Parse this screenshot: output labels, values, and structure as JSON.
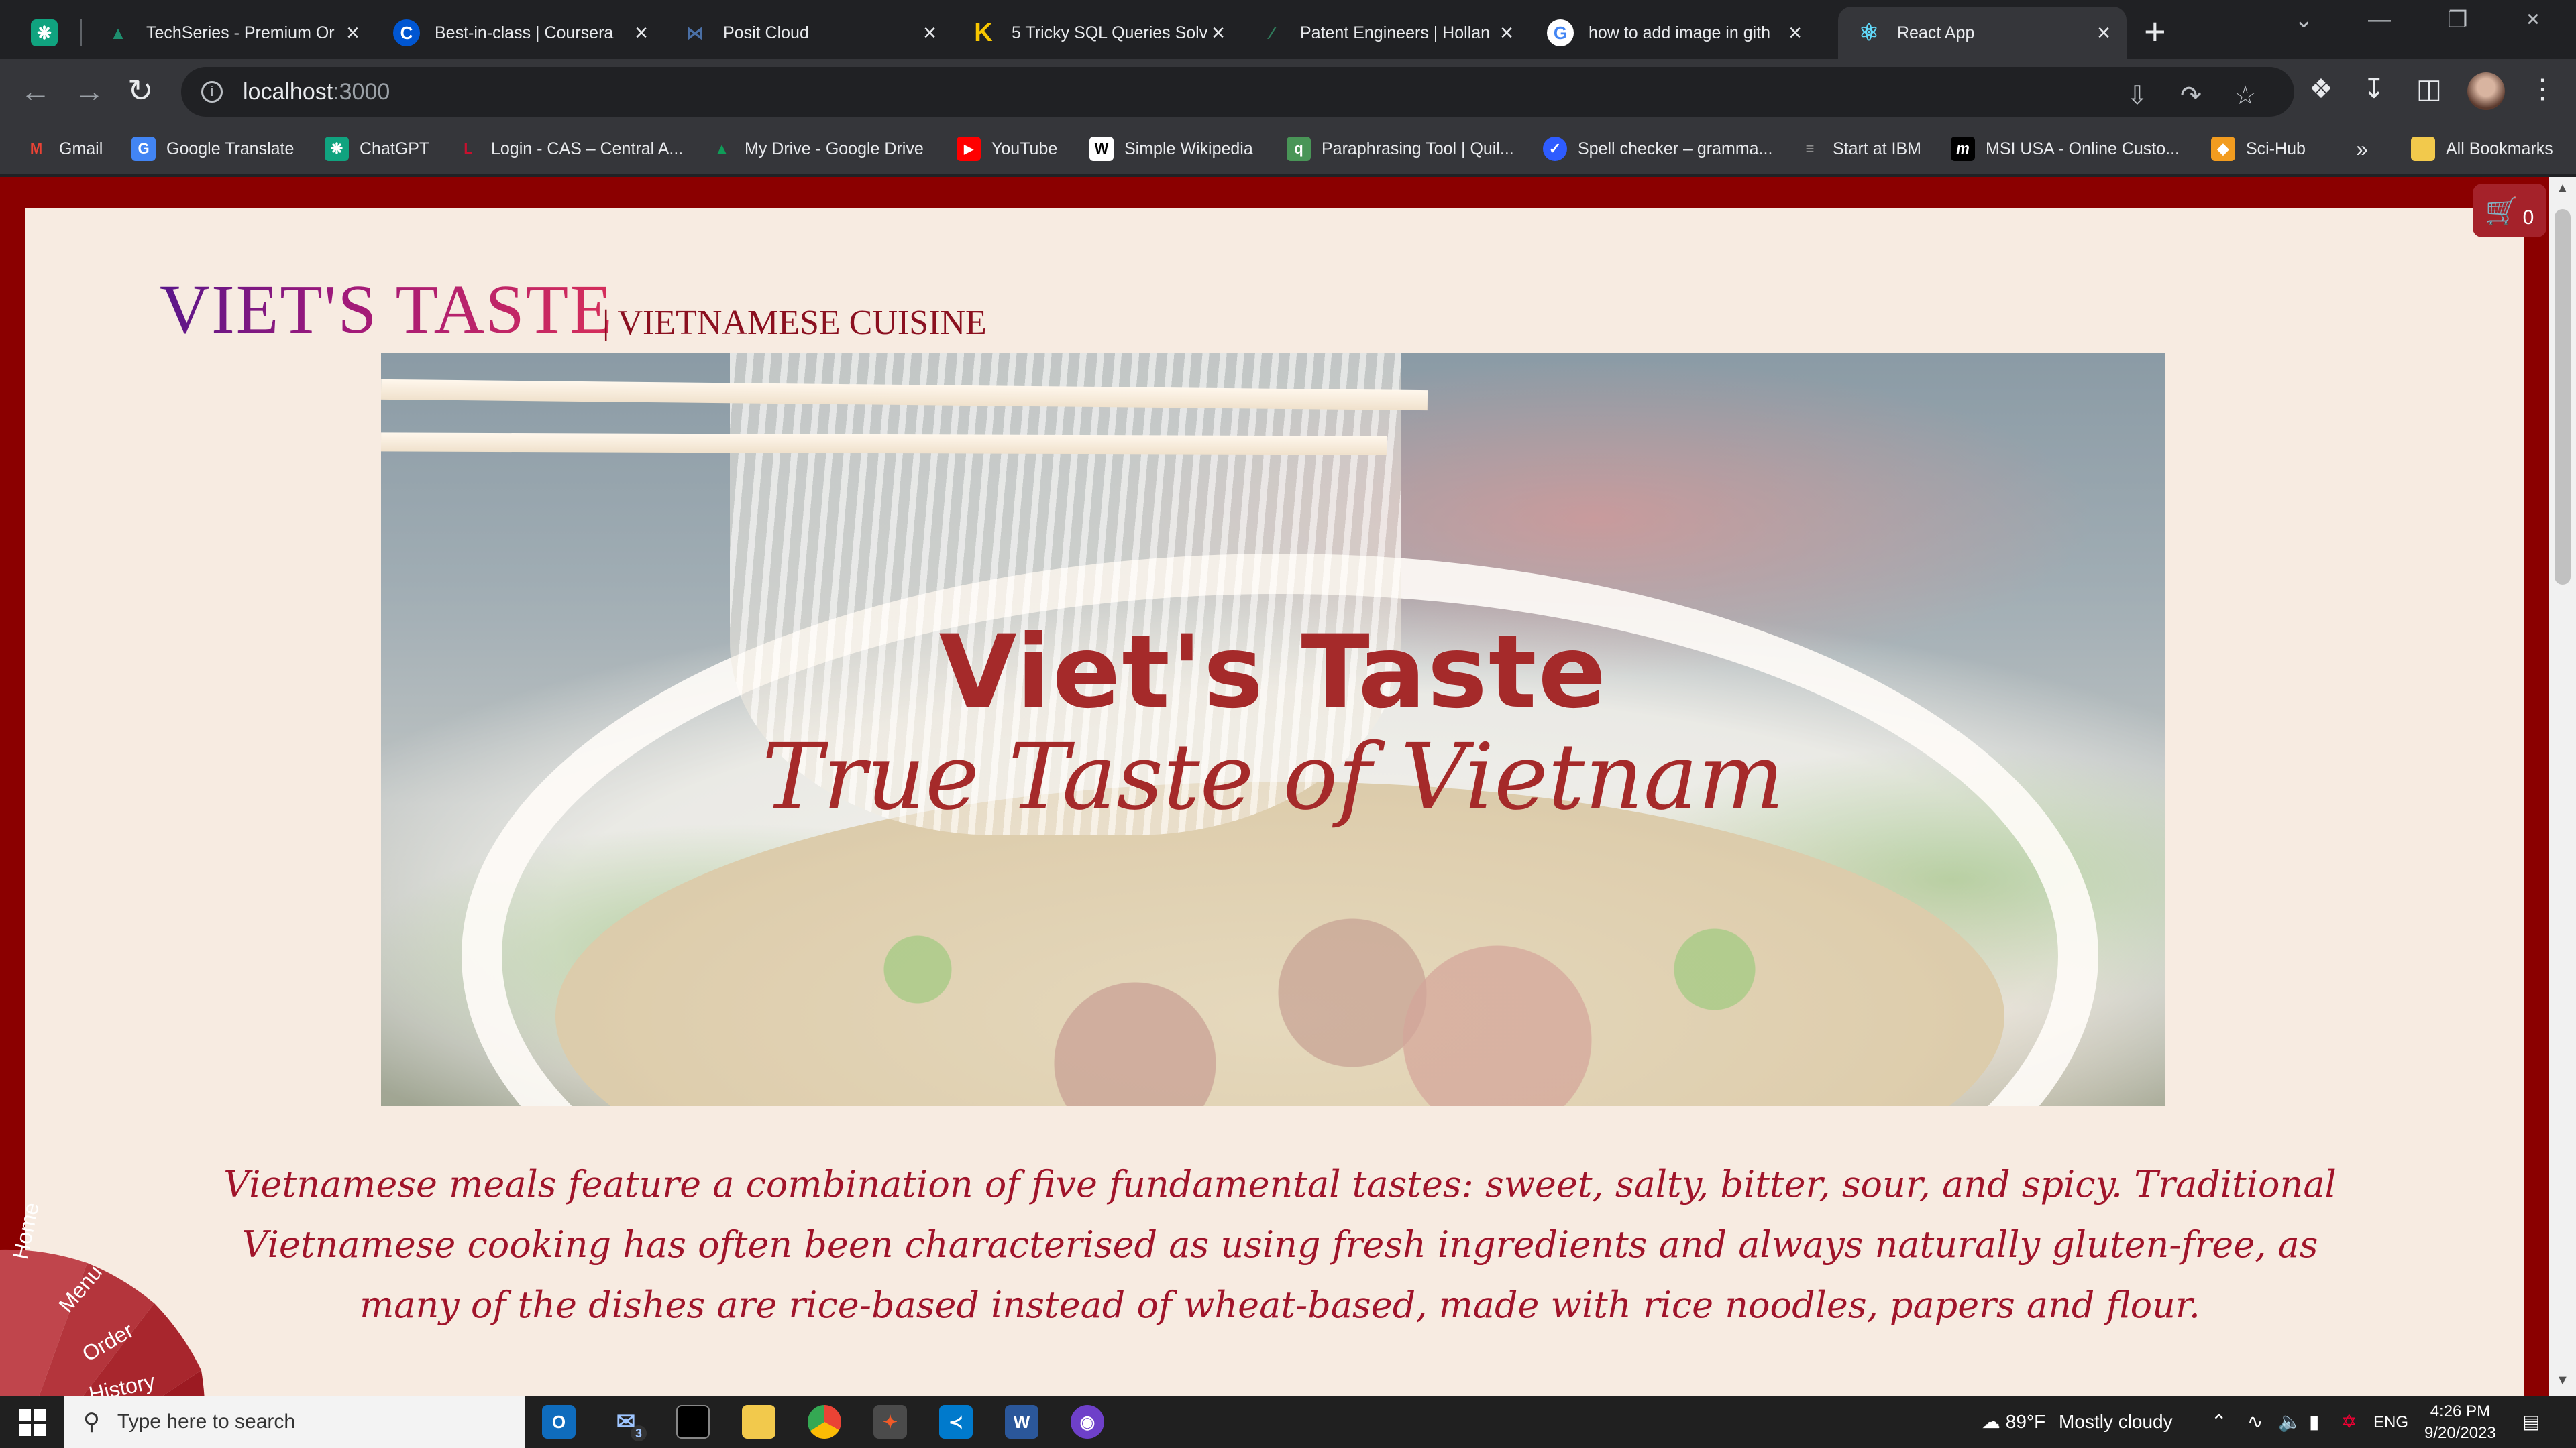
{
  "browser": {
    "tabs": [
      {
        "title": "",
        "favicon": "chatgpt-icon",
        "color": "#10a37f"
      },
      {
        "title": "TechSeries - Premium Or",
        "favicon": "techseries-icon",
        "color": "#1e8e6e"
      },
      {
        "title": "Best-in-class | Coursera",
        "favicon": "coursera-icon",
        "color": "#0056d2"
      },
      {
        "title": "Posit Cloud",
        "favicon": "posit-icon",
        "color": "#4a6fa5"
      },
      {
        "title": "5 Tricky SQL Queries Solv",
        "favicon": "k-icon",
        "color": "#f7c600"
      },
      {
        "title": "Patent Engineers | Hollan",
        "favicon": "patent-icon",
        "color": "#2f7a5a"
      },
      {
        "title": "how to add image in gith",
        "favicon": "google-icon",
        "color": "#ffffff"
      },
      {
        "title": "React App",
        "favicon": "react-icon",
        "color": "#61dafb"
      }
    ],
    "active_tab_index": 7,
    "url_host": "localhost",
    "url_port": ":3000",
    "bookmarks": [
      {
        "label": "Gmail",
        "icon": "gmail-icon",
        "color": "#ea4335"
      },
      {
        "label": "Google Translate",
        "icon": "translate-icon",
        "color": "#4285f4"
      },
      {
        "label": "ChatGPT",
        "icon": "chatgpt-icon",
        "color": "#10a37f"
      },
      {
        "label": "Login - CAS – Central A...",
        "icon": "cas-icon",
        "color": "#c8102e"
      },
      {
        "label": "My Drive - Google Drive",
        "icon": "drive-icon",
        "color": "#0f9d58"
      },
      {
        "label": "YouTube",
        "icon": "youtube-icon",
        "color": "#ff0000"
      },
      {
        "label": "Simple Wikipedia",
        "icon": "wikipedia-icon",
        "color": "#ffffff"
      },
      {
        "label": "Paraphrasing Tool | Quil...",
        "icon": "quillbot-icon",
        "color": "#499557"
      },
      {
        "label": "Spell checker – gramma...",
        "icon": "spellcheck-icon",
        "color": "#2e5cff"
      },
      {
        "label": "Start at IBM",
        "icon": "ibm-icon",
        "color": "#8d8d8d"
      },
      {
        "label": "MSI USA - Online Custo...",
        "icon": "msi-icon",
        "color": "#000000"
      },
      {
        "label": "Sci-Hub",
        "icon": "scihub-icon",
        "color": "#f29c1f"
      }
    ],
    "bookmarks_overflow": "»",
    "all_bookmarks_label": "All Bookmarks"
  },
  "site": {
    "brand": "VIET'S TASTE",
    "brand_sub": "| VIETNAMESE CUISINE",
    "hero_title": "Viet's Taste",
    "hero_tagline": "True Taste of Vietnam",
    "description": "Vietnamese meals feature a combination of five fundamental tastes: sweet, salty, bitter, sour, and spicy. Traditional Vietnamese cooking has often been characterised as using fresh ingredients and always naturally gluten-free, as many of the dishes are rice-based instead of wheat-based, made with rice noodles, papers and flour.",
    "cart_count": "0",
    "pie_menu": [
      "Home",
      "Menu",
      "Order",
      "History"
    ],
    "colors": {
      "frame": "#8b0000",
      "background": "#f7ebe1",
      "accent": "#a52a2a"
    }
  },
  "taskbar": {
    "search_placeholder": "Type here to search",
    "mail_badge": "3",
    "weather_temp": "89°F",
    "weather_text": "Mostly cloudy",
    "language": "ENG",
    "time": "4:26 PM",
    "date": "9/20/2023"
  }
}
